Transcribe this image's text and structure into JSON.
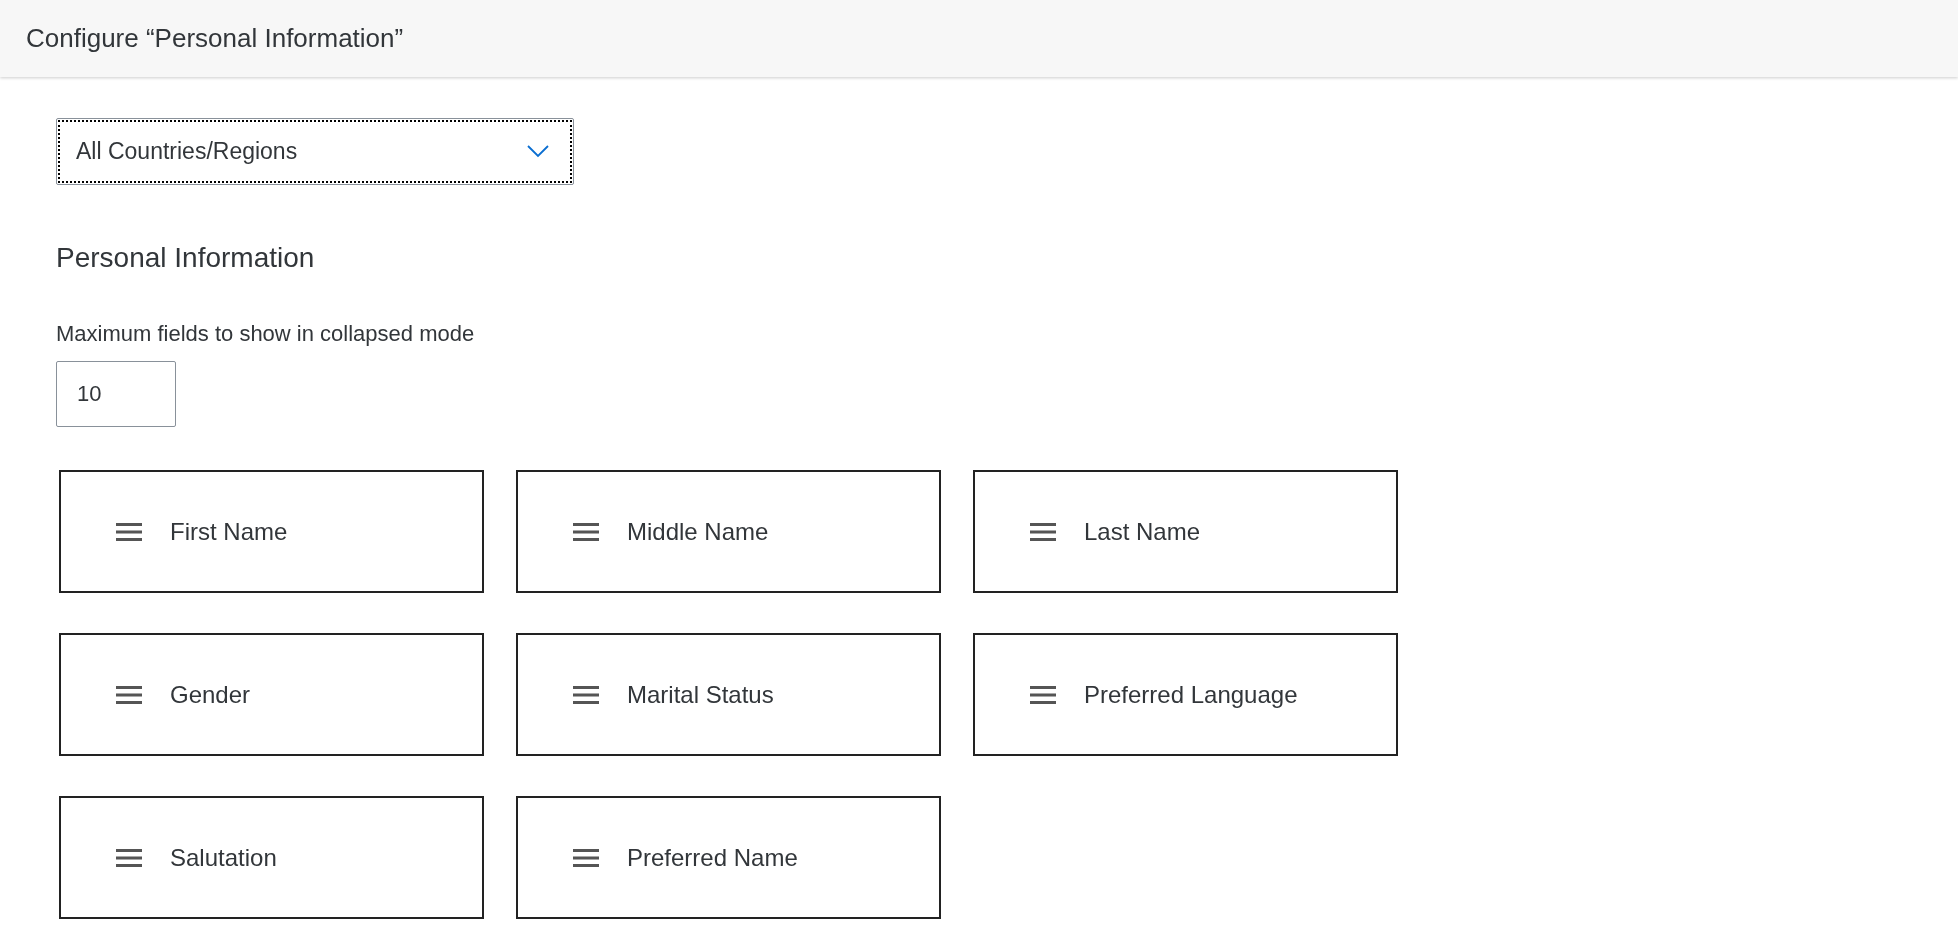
{
  "header": {
    "title": "Configure “Personal Information”"
  },
  "country_select": {
    "value": "All Countries/Regions",
    "focused": true
  },
  "section": {
    "title": "Personal Information",
    "max_fields_label": "Maximum fields to show in collapsed mode",
    "max_fields_value": "10"
  },
  "fields": [
    {
      "label": "First Name"
    },
    {
      "label": "Middle Name"
    },
    {
      "label": "Last Name"
    },
    {
      "label": "Gender"
    },
    {
      "label": "Marital Status"
    },
    {
      "label": "Preferred Language"
    },
    {
      "label": "Salutation"
    },
    {
      "label": "Preferred Name"
    }
  ]
}
